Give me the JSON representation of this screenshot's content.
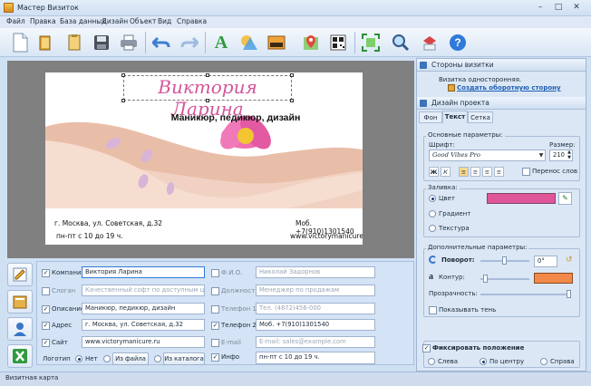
{
  "window": {
    "title": "Мастер Визиток"
  },
  "menu": [
    "Файл",
    "Правка",
    "База данных",
    "Дизайн",
    "Объект",
    "Вид",
    "Справка"
  ],
  "card": {
    "name": "Виктория Ларина",
    "description": "Маникюр, педикюр, дизайн",
    "address": "г. Москва, ул. Советская, д.32",
    "hours": "пн-пт с 10 до 19 ч.",
    "phone": "Моб. +7(910)1301540",
    "site": "www.victorymanicure.ru"
  },
  "fields": {
    "company": {
      "label": "Компания",
      "value": "Виктория Ларина"
    },
    "slogan": {
      "label": "Слоган",
      "placeholder": "Качественный софт по доступным ценам"
    },
    "description": {
      "label": "Описание",
      "value": "Маникюр, педикюр, дизайн"
    },
    "address": {
      "label": "Адрес",
      "value": "г. Москва, ул. Советская, д.32"
    },
    "site": {
      "label": "Сайт",
      "value": "www.victorymanicure.ru"
    },
    "fio": {
      "label": "Ф.И.О.",
      "placeholder": "Николай Задорнов"
    },
    "position": {
      "label": "Должность",
      "placeholder": "Менеджер по продажам"
    },
    "phone1": {
      "label": "Телефон 1",
      "placeholder": "Тел. (4872)456-000"
    },
    "phone2": {
      "label": "Телефон 2",
      "value": "Моб. +7(910)1301540"
    },
    "email": {
      "label": "E-mail",
      "placeholder": "E-mail: sales@example.com"
    },
    "info": {
      "label": "Инфо",
      "value": "пн-пт с 10 до 19 ч."
    },
    "logo": {
      "label": "Логотип",
      "none": "Нет",
      "from_file": "Из файла",
      "from_catalog": "Из каталога"
    }
  },
  "panel": {
    "sides_header": "Стороны визитки",
    "one_sided": "Визитка односторонняя.",
    "create_back": "Создать оборотную сторону",
    "design_header": "Дизайн проекта",
    "tabs": [
      "Фон",
      "Текст",
      "Сетка"
    ],
    "basic_params": "Основные параметры:",
    "font_label": "Шрифт:",
    "font_value": "Good Vibes Pro",
    "size_label": "Размер:",
    "size_value": "210",
    "wrap_label": "Перенос слов",
    "fill_label": "Заливка:",
    "fill_color": "Цвет",
    "fill_gradient": "Градиент",
    "fill_texture": "Текстура",
    "extra_params": "Дополнительные параметры:",
    "rotation_label": "Поворот:",
    "rotation_value": "0°",
    "outline_label": "Контур:",
    "transparency_label": "Прозрачность:",
    "shadow_label": "Показывать тень",
    "fix_position": "Фиксировать положение",
    "align_left": "Слева",
    "align_center": "По центру",
    "align_right": "Справа"
  },
  "colors": {
    "fill": "#e0559a",
    "outline": "#f2894a",
    "accent": "#2f7ad9"
  },
  "status": {
    "text": "Визитная карта"
  }
}
